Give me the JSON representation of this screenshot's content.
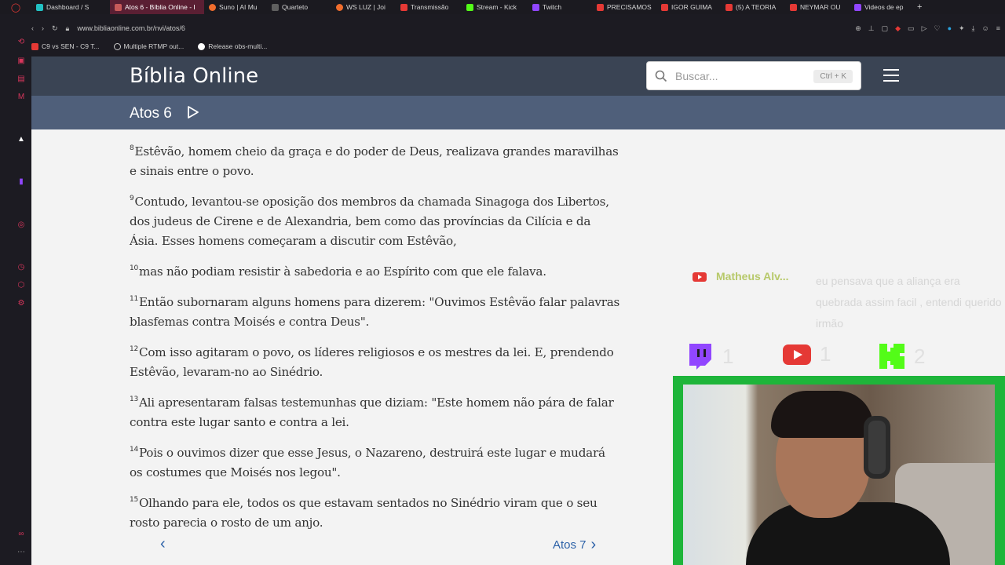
{
  "browser": {
    "tabs": [
      {
        "label": "Dashboard / S",
        "color": "#22c1c3"
      },
      {
        "label": "Atos 6 - Bíblia Online - I",
        "color": "#c85a5a",
        "active": true
      },
      {
        "label": "Suno | AI Mu",
        "color": "#f06d2d"
      },
      {
        "label": "Quarteto",
        "color": "#5f5f5f"
      },
      {
        "label": "WS LUZ | Joi",
        "color": "#f06d2d"
      },
      {
        "label": "Transmissão",
        "color": "#e53935"
      },
      {
        "label": "Stream - Kick",
        "color": "#53fc18"
      },
      {
        "label": "Twitch",
        "color": "#9146ff"
      },
      {
        "label": "PRECISAMOS",
        "color": "#e53935"
      },
      {
        "label": "IGOR GUIMA",
        "color": "#e53935"
      },
      {
        "label": "(5) A TEORIA",
        "color": "#e53935"
      },
      {
        "label": "NEYMAR OU",
        "color": "#e53935"
      },
      {
        "label": "Videos de ep",
        "color": "#9146ff"
      }
    ],
    "url": "www.bibliaonline.com.br/nvi/atos/6",
    "bookmarks": [
      {
        "label": "C9 vs SEN - C9 T...",
        "color": "#e53935"
      },
      {
        "label": "Multiple RTMP out...",
        "color": "#cccccc"
      },
      {
        "label": "Release obs-multi...",
        "color": "#ffffff"
      }
    ]
  },
  "site": {
    "brand": "Bíblia Online",
    "search_placeholder": "Buscar...",
    "search_shortcut": "Ctrl + K",
    "chapter": "Atos 6",
    "verses": [
      {
        "n": "8",
        "text": "Estêvão, homem cheio da graça e do poder de Deus, realizava grandes maravilhas e sinais entre o povo."
      },
      {
        "n": "9",
        "text": "Contudo, levantou-se oposição dos membros da chamada Sinagoga dos Libertos, dos judeus de Cirene e de Alexandria, bem como das províncias da Cilícia e da Ásia. Esses homens começaram a discutir com Estêvão,"
      },
      {
        "n": "10",
        "text": "mas não podiam resistir à sabedoria e ao Espírito com que ele falava."
      },
      {
        "n": "11",
        "text": "Então subornaram alguns homens para dizerem: \"Ouvimos Estêvão falar palavras blasfemas contra Moisés e contra Deus\"."
      },
      {
        "n": "12",
        "text": "Com isso agitaram o povo, os líderes religiosos e os mestres da lei. E, prendendo Estêvão, levaram-no ao Sinédrio."
      },
      {
        "n": "13",
        "text": "Ali apresentaram falsas testemunhas que diziam: \"Este homem não pára de falar contra este lugar santo e contra a lei."
      },
      {
        "n": "14",
        "text": "Pois o ouvimos dizer que esse Jesus, o Nazareno, destruirá este lugar e mudará os costumes que Moisés nos legou\"."
      },
      {
        "n": "15",
        "text": "Olhando para ele, todos os que estavam sentados no Sinédrio viram que o seu rosto parecia o rosto de um anjo."
      }
    ],
    "next_label": "Atos 7"
  },
  "overlay": {
    "chat_user": "Matheus Alv...",
    "chat_message": "eu pensava que a aliança era quebrada assim facil , entendi querido irmão",
    "counters": [
      {
        "platform": "twitch",
        "count": "1",
        "color": "#9146ff"
      },
      {
        "platform": "youtube",
        "count": "1",
        "color": "#e53935"
      },
      {
        "platform": "kick",
        "count": "2",
        "color": "#53fc18"
      }
    ]
  }
}
